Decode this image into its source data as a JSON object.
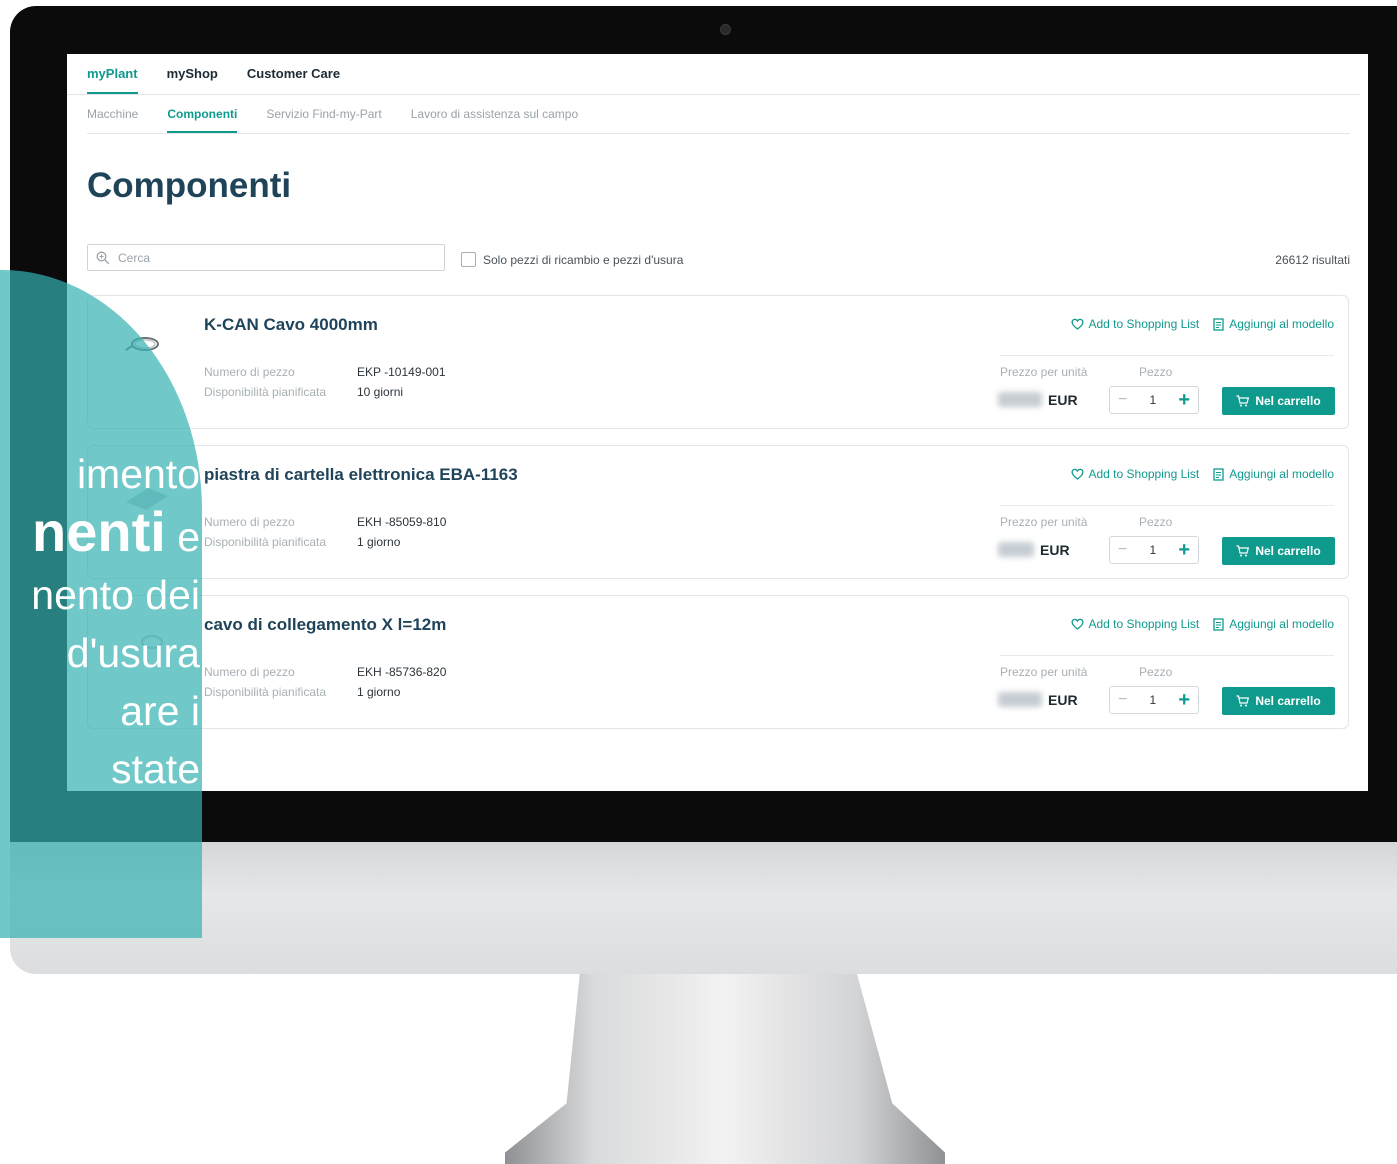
{
  "topnav": [
    "myPlant",
    "myShop",
    "Customer Care"
  ],
  "subnav": [
    "Macchine",
    "Componenti",
    "Servizio Find-my-Part",
    "Lavoro di assistenza sul campo"
  ],
  "page_title": "Componenti",
  "search": {
    "placeholder": "Cerca"
  },
  "filter_label": "Solo pezzi di ricambio e pezzi d'usura",
  "results_count": "26612 risultati",
  "labels": {
    "part_number": "Numero di pezzo",
    "availability": "Disponibilità pianificata",
    "unit_price": "Prezzo per unità",
    "piece": "Pezzo",
    "add_shopping_list": "Add to Shopping List",
    "add_template": "Aggiungi al modello",
    "add_to_cart": "Nel carrello",
    "currency": "EUR"
  },
  "products": [
    {
      "name": "K-CAN Cavo 4000mm",
      "part_number": "EKP -10149-001",
      "availability": "10 giorni",
      "quantity": "1"
    },
    {
      "name": "piastra di cartella elettronica EBA-1163",
      "part_number": "EKH -85059-810",
      "availability": "1 giorno",
      "quantity": "1"
    },
    {
      "name": "cavo di collegamento X l=12m",
      "part_number": "EKH -85736-820",
      "availability": "1 giorno",
      "quantity": "1"
    }
  ],
  "overlay": {
    "line1": "imento",
    "line2_bold": "nenti",
    "line2_rest": " e",
    "line3": "nento dei",
    "line4": "d'usura",
    "line5": "are i",
    "line6": "state"
  },
  "colors": {
    "accent": "#0f9a8e",
    "title": "#1f4459",
    "overlay": "#34b0b0"
  }
}
